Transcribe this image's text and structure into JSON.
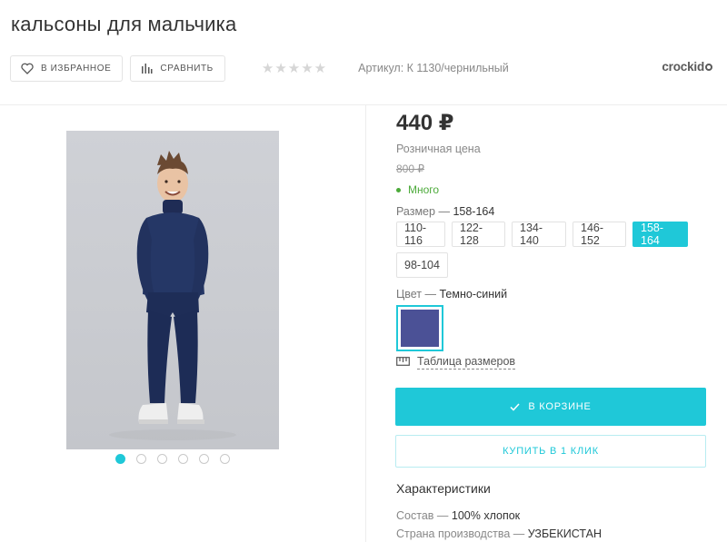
{
  "product": {
    "title": "кальсоны для мальчика",
    "article": "Артикул: К 1130/чернильный"
  },
  "toolbar": {
    "favorite_label": "В ИЗБРАННОЕ",
    "compare_label": "СРАВНИТЬ",
    "rating_stars": [
      "★",
      "★",
      "★",
      "★",
      "★"
    ]
  },
  "brand": {
    "name": "crockid"
  },
  "pricing": {
    "price": "440 ₽",
    "retail_label": "Розничная цена",
    "old_price": "800 ₽",
    "stock": "Много"
  },
  "size": {
    "label": "Размер",
    "sep": "—",
    "selected": "158-164",
    "options": [
      "110-116",
      "122-128",
      "134-140",
      "146-152",
      "158-164",
      "98-104"
    ]
  },
  "color": {
    "label": "Цвет",
    "sep": "—",
    "selected": "Темно-синий",
    "swatch_hex": "#4b5196"
  },
  "size_table": {
    "label": "Таблица размеров"
  },
  "actions": {
    "cart_label": "В КОРЗИНЕ",
    "one_click_label": "КУПИТЬ В 1 КЛИК"
  },
  "characteristics": {
    "title": "Характеристики",
    "rows": [
      {
        "name": "Состав",
        "sep": "—",
        "value": "100% хлопок"
      },
      {
        "name": "Страна производства",
        "sep": "—",
        "value": "УЗБЕКИСТАН"
      }
    ]
  },
  "gallery": {
    "images_count": 6,
    "active_index": 0
  },
  "colors": {
    "accent": "#1fc8d8",
    "stock_green": "#4caa3a"
  }
}
